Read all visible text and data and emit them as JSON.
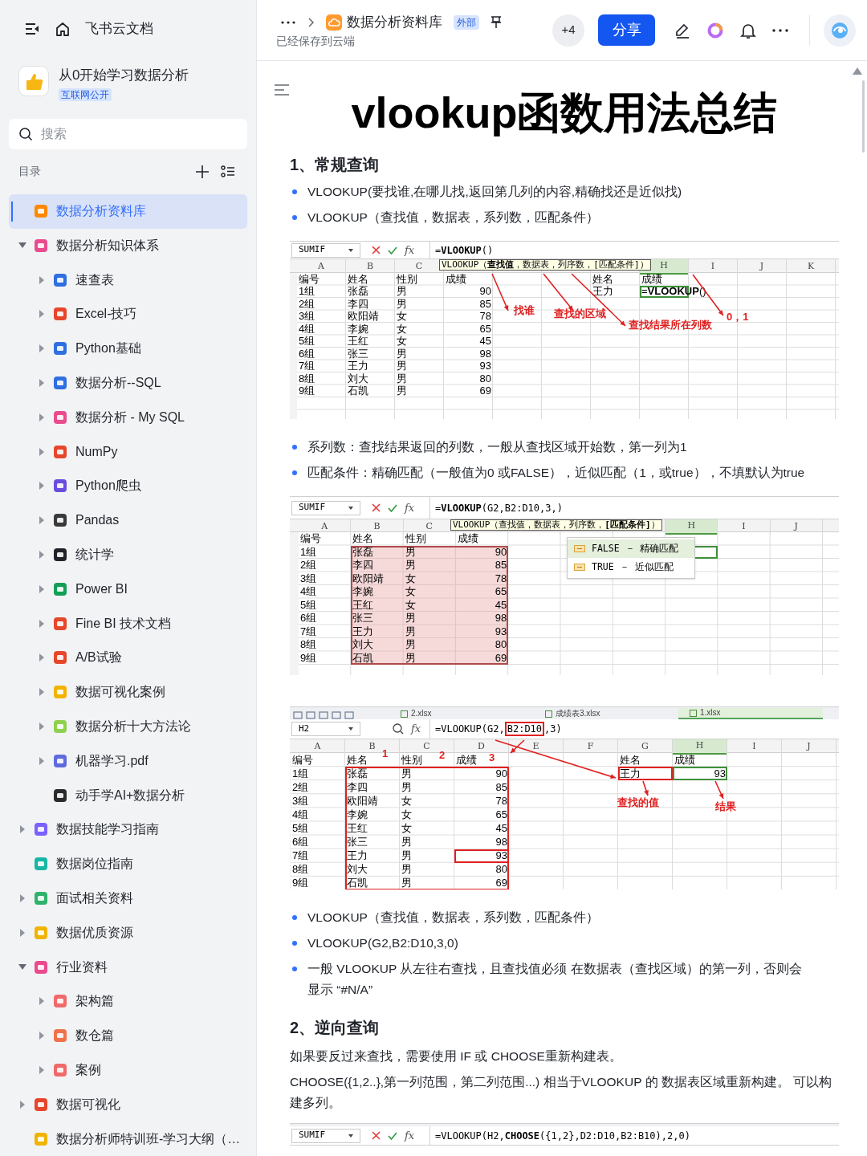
{
  "sidebar": {
    "title": "飞书云文档",
    "space": {
      "name": "从0开始学习数据分析",
      "badge": "互联网公开"
    },
    "search": {
      "placeholder": "搜索"
    },
    "toc_label": "目录",
    "tree": [
      {
        "label": "数据分析资料库",
        "selected": true
      },
      {
        "label": "数据分析知识体系",
        "selected": false,
        "expanded": true,
        "children": [
          {
            "label": "速查表",
            "selected": false,
            "expanded": false
          },
          {
            "label": "Excel-技巧",
            "selected": false,
            "expanded": false
          },
          {
            "label": "Python基础",
            "selected": false,
            "expanded": false
          },
          {
            "label": "数据分析--SQL",
            "selected": false,
            "expanded": false
          },
          {
            "label": "数据分析 - My SQL",
            "selected": false,
            "expanded": false
          },
          {
            "label": "NumPy",
            "selected": false,
            "expanded": false
          },
          {
            "label": "Python爬虫",
            "selected": false,
            "expanded": false
          },
          {
            "label": "Pandas",
            "selected": false,
            "expanded": false
          },
          {
            "label": "统计学",
            "selected": false,
            "expanded": false
          },
          {
            "label": "Power BI",
            "selected": false,
            "expanded": false
          },
          {
            "label": "Fine BI 技术文档",
            "selected": false,
            "expanded": false
          },
          {
            "label": "A/B试验",
            "selected": false,
            "expanded": false
          },
          {
            "label": "数据可视化案例",
            "selected": false,
            "expanded": false
          },
          {
            "label": "数据分析十大方法论",
            "selected": false,
            "expanded": false
          },
          {
            "label": "机器学习.pdf",
            "selected": false,
            "expanded": false
          },
          {
            "label": "动手学AI+数据分析",
            "selected": false
          }
        ]
      },
      {
        "label": "数据技能学习指南",
        "selected": false,
        "expanded": false
      },
      {
        "label": "数据岗位指南",
        "selected": false
      },
      {
        "label": "面试相关资料",
        "selected": false,
        "expanded": false
      },
      {
        "label": "数据优质资源",
        "selected": false,
        "expanded": false
      },
      {
        "label": "行业资料",
        "selected": false,
        "expanded": true,
        "children": [
          {
            "label": "架构篇",
            "selected": false,
            "expanded": false
          },
          {
            "label": "数仓篇",
            "selected": false,
            "expanded": false
          },
          {
            "label": "案例",
            "selected": false,
            "expanded": false
          }
        ]
      },
      {
        "label": "数据可视化",
        "selected": false,
        "expanded": false
      },
      {
        "label": "数据分析师特训班-学习大纲（…",
        "selected": false
      }
    ]
  },
  "header": {
    "breadcrumb": "数据分析资料库",
    "badge": "外部",
    "status": "已经保存到云端",
    "collaborators": "+4",
    "share": "分享"
  },
  "document": {
    "title": "vlookup函数用法总结",
    "blocks": [
      {
        "kind": "heading",
        "text": "1、常规查询"
      },
      {
        "kind": "bullet",
        "text": "VLOOKUP(要找谁,在哪儿找,返回第几列的内容,精确找还是近似找)"
      },
      {
        "kind": "bullet",
        "text": "VLOOKUP（查找值，数据表，系列数，匹配条件）"
      },
      {
        "kind": "sheet",
        "formula_bar": {
          "kind": "editing",
          "name_box": "SUMIF",
          "fx": "fx",
          "formula": "=**VLOOKUP**()"
        },
        "columns": [
          "A",
          "B",
          "C",
          null,
          null,
          null,
          null,
          "H",
          "I",
          "J",
          "K"
        ],
        "tooltip": "VLOOKUP（**查找值**，数据表，列序数，[匹配条件]）",
        "rows": [
          [
            "编号",
            "姓名",
            "性别",
            "成绩",
            null,
            null,
            "姓名",
            "成绩"
          ],
          [
            "1组",
            "张磊",
            "男",
            "90",
            null,
            null,
            "王力",
            {
              "text": "=**VLOOKUP**()",
              "selected": true
            }
          ],
          [
            "2组",
            "李四",
            "男",
            "85"
          ],
          [
            "3组",
            "欧阳靖",
            "女",
            "78"
          ],
          [
            "4组",
            "李婉",
            "女",
            "65"
          ],
          [
            "5组",
            "王红",
            "女",
            "45"
          ],
          [
            "6组",
            "张三",
            "男",
            "98"
          ],
          [
            "7组",
            "王力",
            "男",
            "93"
          ],
          [
            "8组",
            "刘大",
            "男",
            "80"
          ],
          [
            "9组",
            "石凯",
            "男",
            "69"
          ]
        ],
        "annotations": [
          "找谁",
          "查找的区域",
          "查找结果所在列数",
          "0，1"
        ]
      },
      {
        "kind": "bullet",
        "text": "系列数：查找结果返回的列数，一般从查找区域开始数，第一列为1"
      },
      {
        "kind": "bullet",
        "text": "匹配条件：精确匹配（一般值为0 或FALSE），近似匹配（1，或true），不填默认为true"
      },
      {
        "kind": "sheet",
        "formula_bar": {
          "kind": "editing",
          "name_box": "SUMIF",
          "fx": "fx",
          "formula": "=**VLOOKUP**(G2,B2:D10,3,)"
        },
        "columns": [
          "A",
          "B",
          "C",
          null,
          null,
          null,
          null,
          "H",
          "I",
          "J"
        ],
        "tooltip": "VLOOKUP（查找值，数据表，列序数，**[匹配条件]**）",
        "dropdown": [
          {
            "text": "FALSE － 精确匹配",
            "selected": true
          },
          {
            "text": "TRUE － 近似匹配",
            "selected": false
          }
        ],
        "rows": [
          [
            "编号",
            "姓名",
            "性别",
            "成绩"
          ],
          [
            "1组",
            "张磊",
            "男",
            "90",
            null,
            null,
            null,
            {
              "selected": true
            }
          ],
          [
            "2组",
            "李四",
            "男",
            "85"
          ],
          [
            "3组",
            "欧阳靖",
            "女",
            "78"
          ],
          [
            "4组",
            "李婉",
            "女",
            "65"
          ],
          [
            "5组",
            "王红",
            "女",
            "45"
          ],
          [
            "6组",
            "张三",
            "男",
            "98"
          ],
          [
            "7组",
            "王力",
            "男",
            "93"
          ],
          [
            "8组",
            "刘大",
            "男",
            "80"
          ],
          [
            "9组",
            "石凯",
            "男",
            "69"
          ]
        ]
      },
      {
        "kind": "sheet",
        "tabs": [
          {
            "label": "2.xlsx",
            "selected": false
          },
          {
            "label": "成绩表3.xlsx",
            "selected": false
          },
          {
            "label": "1.xlsx",
            "selected": true
          }
        ],
        "formula_bar": {
          "kind": "idle",
          "name_box": "H2",
          "fx": "fx",
          "formula": [
            {
              "text": "=VLOOKUP(G2,",
              "boxed": false
            },
            {
              "text": "B2:D10",
              "boxed": true
            },
            {
              "text": ",3)",
              "boxed": false
            }
          ]
        },
        "columns": [
          "A",
          "B",
          "C",
          "D",
          "E",
          "F",
          "G",
          "H",
          "I",
          "J"
        ],
        "rows": [
          [
            "编号",
            "姓名",
            "性别",
            "成绩",
            null,
            null,
            "姓名",
            "成绩"
          ],
          [
            "1组",
            "张磊",
            "男",
            "90",
            null,
            null,
            "王力",
            {
              "text": "93",
              "selected": true
            }
          ],
          [
            "2组",
            "李四",
            "男",
            "85"
          ],
          [
            "3组",
            "欧阳靖",
            "女",
            "78"
          ],
          [
            "4组",
            "李婉",
            "女",
            "65"
          ],
          [
            "5组",
            "王红",
            "女",
            "45"
          ],
          [
            "6组",
            "张三",
            "男",
            "98"
          ],
          [
            "7组",
            "王力",
            "男",
            "93"
          ],
          [
            "8组",
            "刘大",
            "男",
            "80"
          ],
          [
            "9组",
            "石凯",
            "男",
            "69"
          ]
        ],
        "annotations": [
          "1",
          "2",
          "3",
          "查找的值",
          "结果"
        ]
      },
      {
        "kind": "bullet",
        "text": "VLOOKUP（查找值，数据表，系列数，匹配条件）"
      },
      {
        "kind": "bullet",
        "text": "VLOOKUP(G2,B2:D10,3,0)"
      },
      {
        "kind": "bullet",
        "text": "一般 VLOOKUP 从左往右查找，且查找值必须 在数据表（查找区域）的第一列，否则会显示 “#N/A”"
      },
      {
        "kind": "heading",
        "text": "2、逆向查询"
      },
      {
        "kind": "paragraph",
        "text": "如果要反过来查找，需要使用 IF 或 CHOOSE重新构建表。"
      },
      {
        "kind": "paragraph",
        "text": "CHOOSE({1,2..},第一列范围，第二列范围...) 相当于VLOOKUP 的 数据表区域重新构建。 可以构建多列。"
      },
      {
        "kind": "sheet",
        "formula_bar": {
          "kind": "editing",
          "name_box": "SUMIF",
          "fx": "fx",
          "formula": "=VLOOKUP(H2,**CHOOSE**({1,2},D2:D10,B2:B10),2,0)"
        }
      }
    ]
  }
}
